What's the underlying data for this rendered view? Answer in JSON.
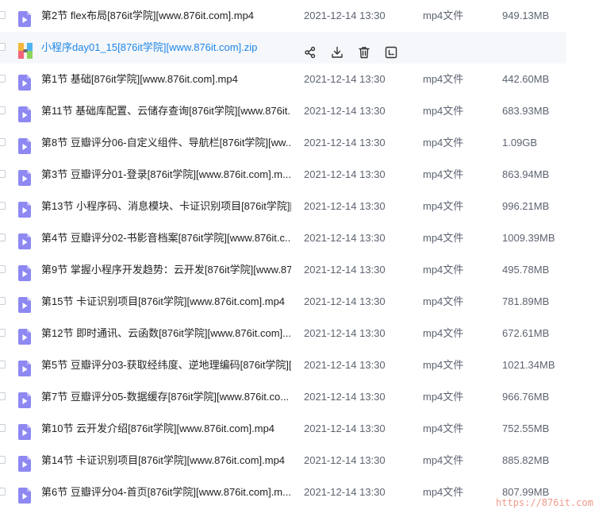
{
  "colors": {
    "accent": "#1f86e6",
    "video_icon": "#8d88f2",
    "row_highlight": "#f5f7fb",
    "watermark": "#f09a8a"
  },
  "highlighted_row_actions": [
    {
      "name": "share-icon"
    },
    {
      "name": "download-icon"
    },
    {
      "name": "delete-icon"
    },
    {
      "name": "more-icon"
    }
  ],
  "files": [
    {
      "name": "第2节 flex布局[876it学院][www.876it.com].mp4",
      "date": "2021-12-14 13:30",
      "type": "mp4文件",
      "size": "949.13MB",
      "icon": "video-file-icon"
    },
    {
      "name": "小程序day01_15[876it学院][www.876it.com].zip",
      "date": "",
      "type": "",
      "size": "",
      "icon": "zip-file-icon",
      "highlight": true
    },
    {
      "name": "第1节 基础[876it学院][www.876it.com].mp4",
      "date": "2021-12-14 13:30",
      "type": "mp4文件",
      "size": "442.60MB",
      "icon": "video-file-icon"
    },
    {
      "name": "第11节 基础库配置、云储存查询[876it学院][www.876it....",
      "date": "2021-12-14 13:30",
      "type": "mp4文件",
      "size": "683.93MB",
      "icon": "video-file-icon"
    },
    {
      "name": "第8节 豆瓣评分06-自定义组件、导航栏[876it学院][ww...",
      "date": "2021-12-14 13:30",
      "type": "mp4文件",
      "size": "1.09GB",
      "icon": "video-file-icon"
    },
    {
      "name": "第3节 豆瓣评分01-登录[876it学院][www.876it.com].m...",
      "date": "2021-12-14 13:30",
      "type": "mp4文件",
      "size": "863.94MB",
      "icon": "video-file-icon"
    },
    {
      "name": "第13节 小程序码、消息模块、卡证识别项目[876it学院][...",
      "date": "2021-12-14 13:30",
      "type": "mp4文件",
      "size": "996.21MB",
      "icon": "video-file-icon"
    },
    {
      "name": "第4节 豆瓣评分02-书影音档案[876it学院][www.876it.c...",
      "date": "2021-12-14 13:30",
      "type": "mp4文件",
      "size": "1009.39MB",
      "icon": "video-file-icon"
    },
    {
      "name": "第9节 掌握小程序开发趋势：云开发[876it学院][www.87...",
      "date": "2021-12-14 13:30",
      "type": "mp4文件",
      "size": "495.78MB",
      "icon": "video-file-icon"
    },
    {
      "name": "第15节  卡证识别项目[876it学院][www.876it.com].mp4",
      "date": "2021-12-14 13:30",
      "type": "mp4文件",
      "size": "781.89MB",
      "icon": "video-file-icon"
    },
    {
      "name": "第12节  即时通讯、云函数[876it学院][www.876it.com]....",
      "date": "2021-12-14 13:30",
      "type": "mp4文件",
      "size": "672.61MB",
      "icon": "video-file-icon"
    },
    {
      "name": "第5节 豆瓣评分03-获取经纬度、逆地理编码[876it学院][...",
      "date": "2021-12-14 13:30",
      "type": "mp4文件",
      "size": "1021.34MB",
      "icon": "video-file-icon"
    },
    {
      "name": "第7节 豆瓣评分05-数据缓存[876it学院][www.876it.co...",
      "date": "2021-12-14 13:30",
      "type": "mp4文件",
      "size": "966.76MB",
      "icon": "video-file-icon"
    },
    {
      "name": "第10节 云开发介绍[876it学院][www.876it.com].mp4",
      "date": "2021-12-14 13:30",
      "type": "mp4文件",
      "size": "752.55MB",
      "icon": "video-file-icon"
    },
    {
      "name": "第14节 卡证识别项目[876it学院][www.876it.com].mp4",
      "date": "2021-12-14 13:30",
      "type": "mp4文件",
      "size": "885.82MB",
      "icon": "video-file-icon"
    },
    {
      "name": "第6节 豆瓣评分04-首页[876it学院][www.876it.com].m...",
      "date": "2021-12-14 13:30",
      "type": "mp4文件",
      "size": "807.99MB",
      "icon": "video-file-icon"
    }
  ],
  "watermark": "https://876it.com"
}
